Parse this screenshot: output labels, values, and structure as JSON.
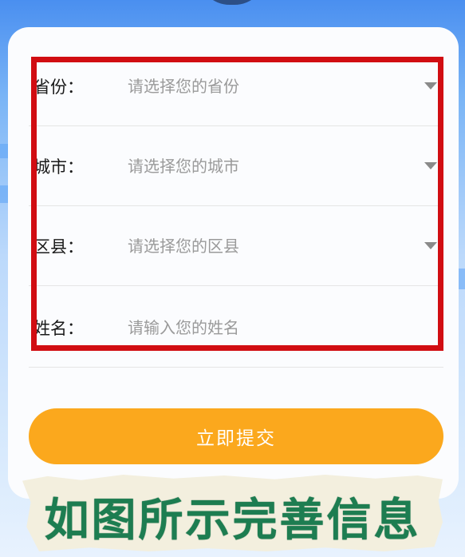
{
  "form": {
    "rows": [
      {
        "label": "省份：",
        "placeholder": "请选择您的省份",
        "type": "select"
      },
      {
        "label": "城市：",
        "placeholder": "请选择您的城市",
        "type": "select"
      },
      {
        "label": "区县：",
        "placeholder": "请选择您的区县",
        "type": "select"
      },
      {
        "label": "姓名：",
        "placeholder": "请输入您的姓名",
        "type": "text"
      }
    ],
    "submit_label": "立即提交"
  },
  "banner": {
    "text": "如图所示完善信息"
  },
  "colors": {
    "highlight_border": "#d10d12",
    "submit_button": "#fba81d",
    "banner_text": "#1d7d51",
    "background_top": "#4a8ff0"
  },
  "icons": [
    "dropdown-arrow-icon"
  ]
}
